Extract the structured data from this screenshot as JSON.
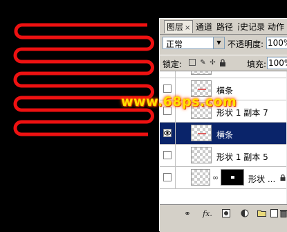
{
  "watermark": "www.68ps.com",
  "colors": {
    "shape_red": "#ee1111",
    "selection_blue": "#0a246a",
    "panel_gray": "#d4d0c8"
  },
  "panel": {
    "tabs": [
      {
        "label": "图层",
        "close": "×",
        "active": true
      },
      {
        "label": "通道"
      },
      {
        "label": "路径"
      },
      {
        "label": "历史记录"
      },
      {
        "label": "动作"
      }
    ],
    "blend_mode": "正常",
    "opacity_label": "不透明度:",
    "opacity_value": "100%",
    "lock_label": "锁定:",
    "fill_label": "填充:",
    "fill_value": "100%",
    "layers": [
      {
        "name": "横条",
        "visible": false,
        "selected": false
      },
      {
        "name": "形状 1 副本 7",
        "visible": false,
        "selected": false
      },
      {
        "name": "横条",
        "visible": true,
        "selected": true
      },
      {
        "name": "形状 1 副本 5",
        "visible": false,
        "selected": false
      },
      {
        "name": "形状 ...",
        "visible": false,
        "selected": false
      }
    ]
  },
  "icons": {
    "lock": [
      "transparency-lock-icon",
      "brush-lock-icon",
      "move-lock-icon",
      "padlock-icon"
    ],
    "bottom_bar": [
      "link-layers-icon",
      "fx-icon",
      "mask-icon",
      "adjustment-icon",
      "folder-icon",
      "new-layer-icon",
      "trash-icon"
    ]
  }
}
